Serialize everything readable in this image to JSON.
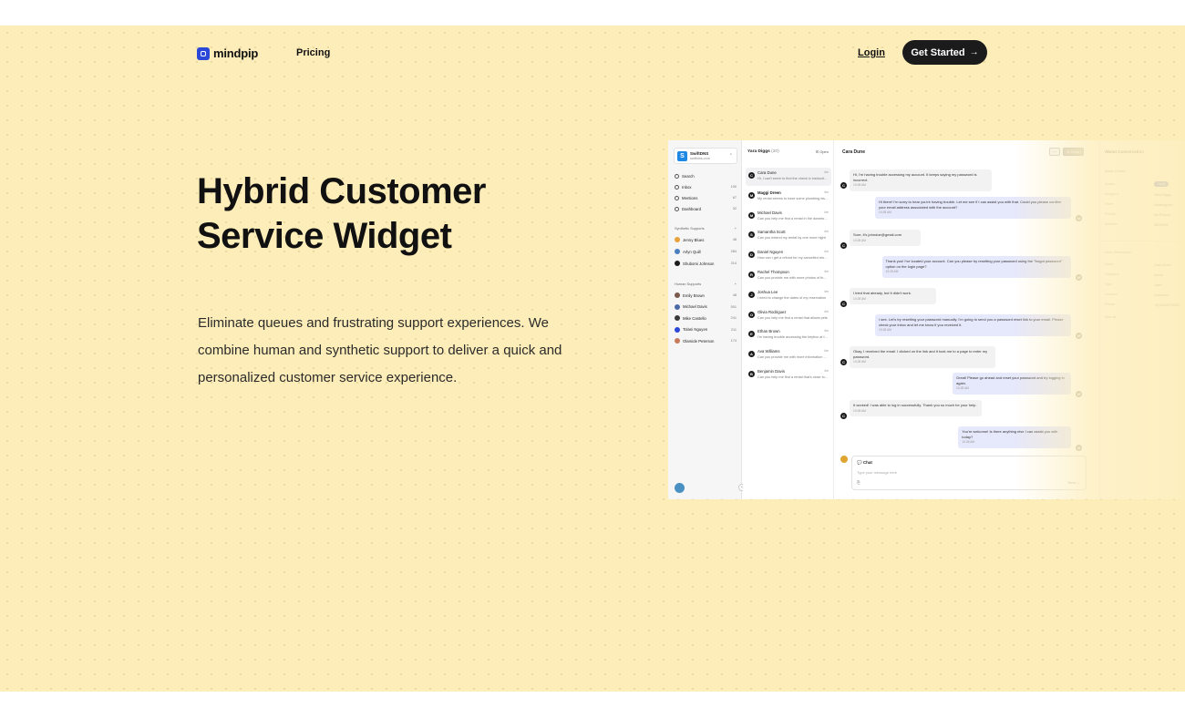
{
  "nav": {
    "brand": "mindpip",
    "links": [
      "Pricing"
    ],
    "login": "Login",
    "cta": "Get Started",
    "cta_arrow": "→"
  },
  "hero": {
    "headline_line1": "Hybrid Customer",
    "headline_line2": "Service Widget",
    "description": "Eliminate queues and frustrating support experiences. We combine human and synthetic support to deliver a quick and personalized customer service experience."
  },
  "app": {
    "workspace": {
      "badge": "S",
      "name": "SwiftDNS",
      "sub": "swiftdns.com",
      "chevron": "⌃"
    },
    "nav_items": [
      {
        "label": "Search",
        "count": ""
      },
      {
        "label": "Inbox",
        "count": "100"
      },
      {
        "label": "Mentions",
        "count": "67"
      },
      {
        "label": "Dashboard",
        "count": "32"
      }
    ],
    "synthetic_title": "Synthetic Supports",
    "synthetic": [
      {
        "label": "Jenny Blues",
        "count": "48",
        "color": "#e8a23a"
      },
      {
        "label": "Arlyn Quill",
        "count": "284",
        "color": "#4a7fc1"
      },
      {
        "label": "Shubomi Johnson",
        "count": "214",
        "color": "#1b1b1b"
      }
    ],
    "human_title": "Human Supports",
    "human": [
      {
        "label": "Emily Brown",
        "count": "48",
        "color": "#7a5a4a"
      },
      {
        "label": "Michael Davis",
        "count": "501",
        "color": "#4c6aa8"
      },
      {
        "label": "Mike Castello",
        "count": "241",
        "color": "#3a3a3a"
      },
      {
        "label": "Tolani Nguyen",
        "count": "211",
        "color": "#2b48d8"
      },
      {
        "label": "Olamide Peterson",
        "count": "174",
        "color": "#c77a5a"
      }
    ],
    "plus": "+",
    "list_title": "Yara Diggs",
    "list_count": "(20)",
    "list_filter": "☰ Open",
    "conversations": [
      {
        "initial": "C",
        "name": "Cara Dune",
        "time": "4m",
        "preview": "Hi, I can't seem to find the check in instructions",
        "active": true,
        "bold": false
      },
      {
        "initial": "M",
        "name": "Maggi Dreen",
        "time": "4m",
        "preview": "My rental seems to have some plumbing issues",
        "active": false,
        "bold": true
      },
      {
        "initial": "M",
        "name": "Michael Davis",
        "time": "4m",
        "preview": "Can you help me find a rental in the downtown area",
        "active": false,
        "bold": false
      },
      {
        "initial": "S",
        "name": "Samantha Scott",
        "time": "4m",
        "preview": "Can you extend my rental by one more night",
        "active": false,
        "bold": false
      },
      {
        "initial": "D",
        "name": "Daniel Nguyen",
        "time": "4m",
        "preview": "How can i get a refund for my cancelled reservation",
        "active": false,
        "bold": false
      },
      {
        "initial": "R",
        "name": "Rachel Thompson",
        "time": "4m",
        "preview": "Can you provide me with more photos of the place",
        "active": false,
        "bold": false
      },
      {
        "initial": "J",
        "name": "Joshua Lee",
        "time": "4m",
        "preview": "I need to change the dates of my reservation",
        "active": false,
        "bold": false
      },
      {
        "initial": "O",
        "name": "Olivia Rodriguez",
        "time": "4m",
        "preview": "Can you help me find a rental that allows pets",
        "active": false,
        "bold": false
      },
      {
        "initial": "E",
        "name": "Ethan Brown",
        "time": "4m",
        "preview": "I'm having trouble accessing the keybox at the rental",
        "active": false,
        "bold": false
      },
      {
        "initial": "A",
        "name": "Ava Williams",
        "time": "4m",
        "preview": "Can you provide me with more information about the area",
        "active": false,
        "bold": false
      },
      {
        "initial": "B",
        "name": "Benjamin Davis",
        "time": "4m",
        "preview": "Can you help me find a rental that's close to the beach",
        "active": false,
        "bold": false
      }
    ],
    "chat_title": "Cara Dune",
    "chat_more": "···",
    "chat_close": "⊘ Close",
    "messages": [
      {
        "side": "in",
        "text": "Hi, I'm having trouble accessing my account. It keeps saying my password is incorrect.",
        "time": "10:28 AM"
      },
      {
        "side": "out",
        "text": "Hi there! I'm sorry to hear you're having trouble. Let me see if I can assist you with that. Could you please confirm your email address associated with the account?",
        "time": "10:28 AM"
      },
      {
        "side": "in",
        "text": "Sure, it's johndoe@gmail.com",
        "time": "10:28 AM"
      },
      {
        "side": "out",
        "text": "Thank you! I've located your account. Can you please try resetting your password using the \"forgot password\" option on the login page?",
        "time": "10:28 AM"
      },
      {
        "side": "in",
        "text": "I tried that already, but it didn't work.",
        "time": "10:28 AM"
      },
      {
        "side": "out",
        "text": "I see. Let's try resetting your password manually. I'm going to send you a password reset link to your email. Please check your inbox and let me know if you received it.",
        "time": "10:28 AM"
      },
      {
        "side": "in",
        "text": "Okay, I received the email. I clicked on the link and it took me to a page to enter my password.",
        "time": "10:28 AM"
      },
      {
        "side": "out",
        "text": "Great! Please go ahead and reset your password and try logging in again.",
        "time": "10:28 AM"
      },
      {
        "side": "in",
        "text": "It worked! I was able to log in successfully. Thank you so much for your help.",
        "time": "10:28 AM"
      },
      {
        "side": "out",
        "text": "You're welcome! Is there anything else I can assist you with today?",
        "time": "10:28 AM"
      }
    ],
    "composer": {
      "label": "💬 Chat",
      "placeholder": "Type your message here",
      "attach": "⎘",
      "send": "Send  ⌄"
    },
    "about": {
      "title": "About Conversation",
      "basic_title": "Basic Details",
      "basic": [
        {
          "k": "Status",
          "v": "Open"
        },
        {
          "k": "Assignee",
          "v": "Yara Diggs"
        },
        {
          "k": "Team",
          "v": "Unassigned"
        },
        {
          "k": "Priority",
          "v": "No Priority"
        },
        {
          "k": "Identifier",
          "v": "2003993"
        }
      ],
      "user_title": "User Information",
      "user": [
        {
          "k": "Name",
          "v": "Cara Dune"
        },
        {
          "k": "Company",
          "v": "Acme"
        },
        {
          "k": "Type",
          "v": "User"
        },
        {
          "k": "Location",
          "v": "Unknown"
        },
        {
          "k": "Phone",
          "v": "+1(415)8734682"
        }
      ],
      "see_all": "See all"
    }
  }
}
